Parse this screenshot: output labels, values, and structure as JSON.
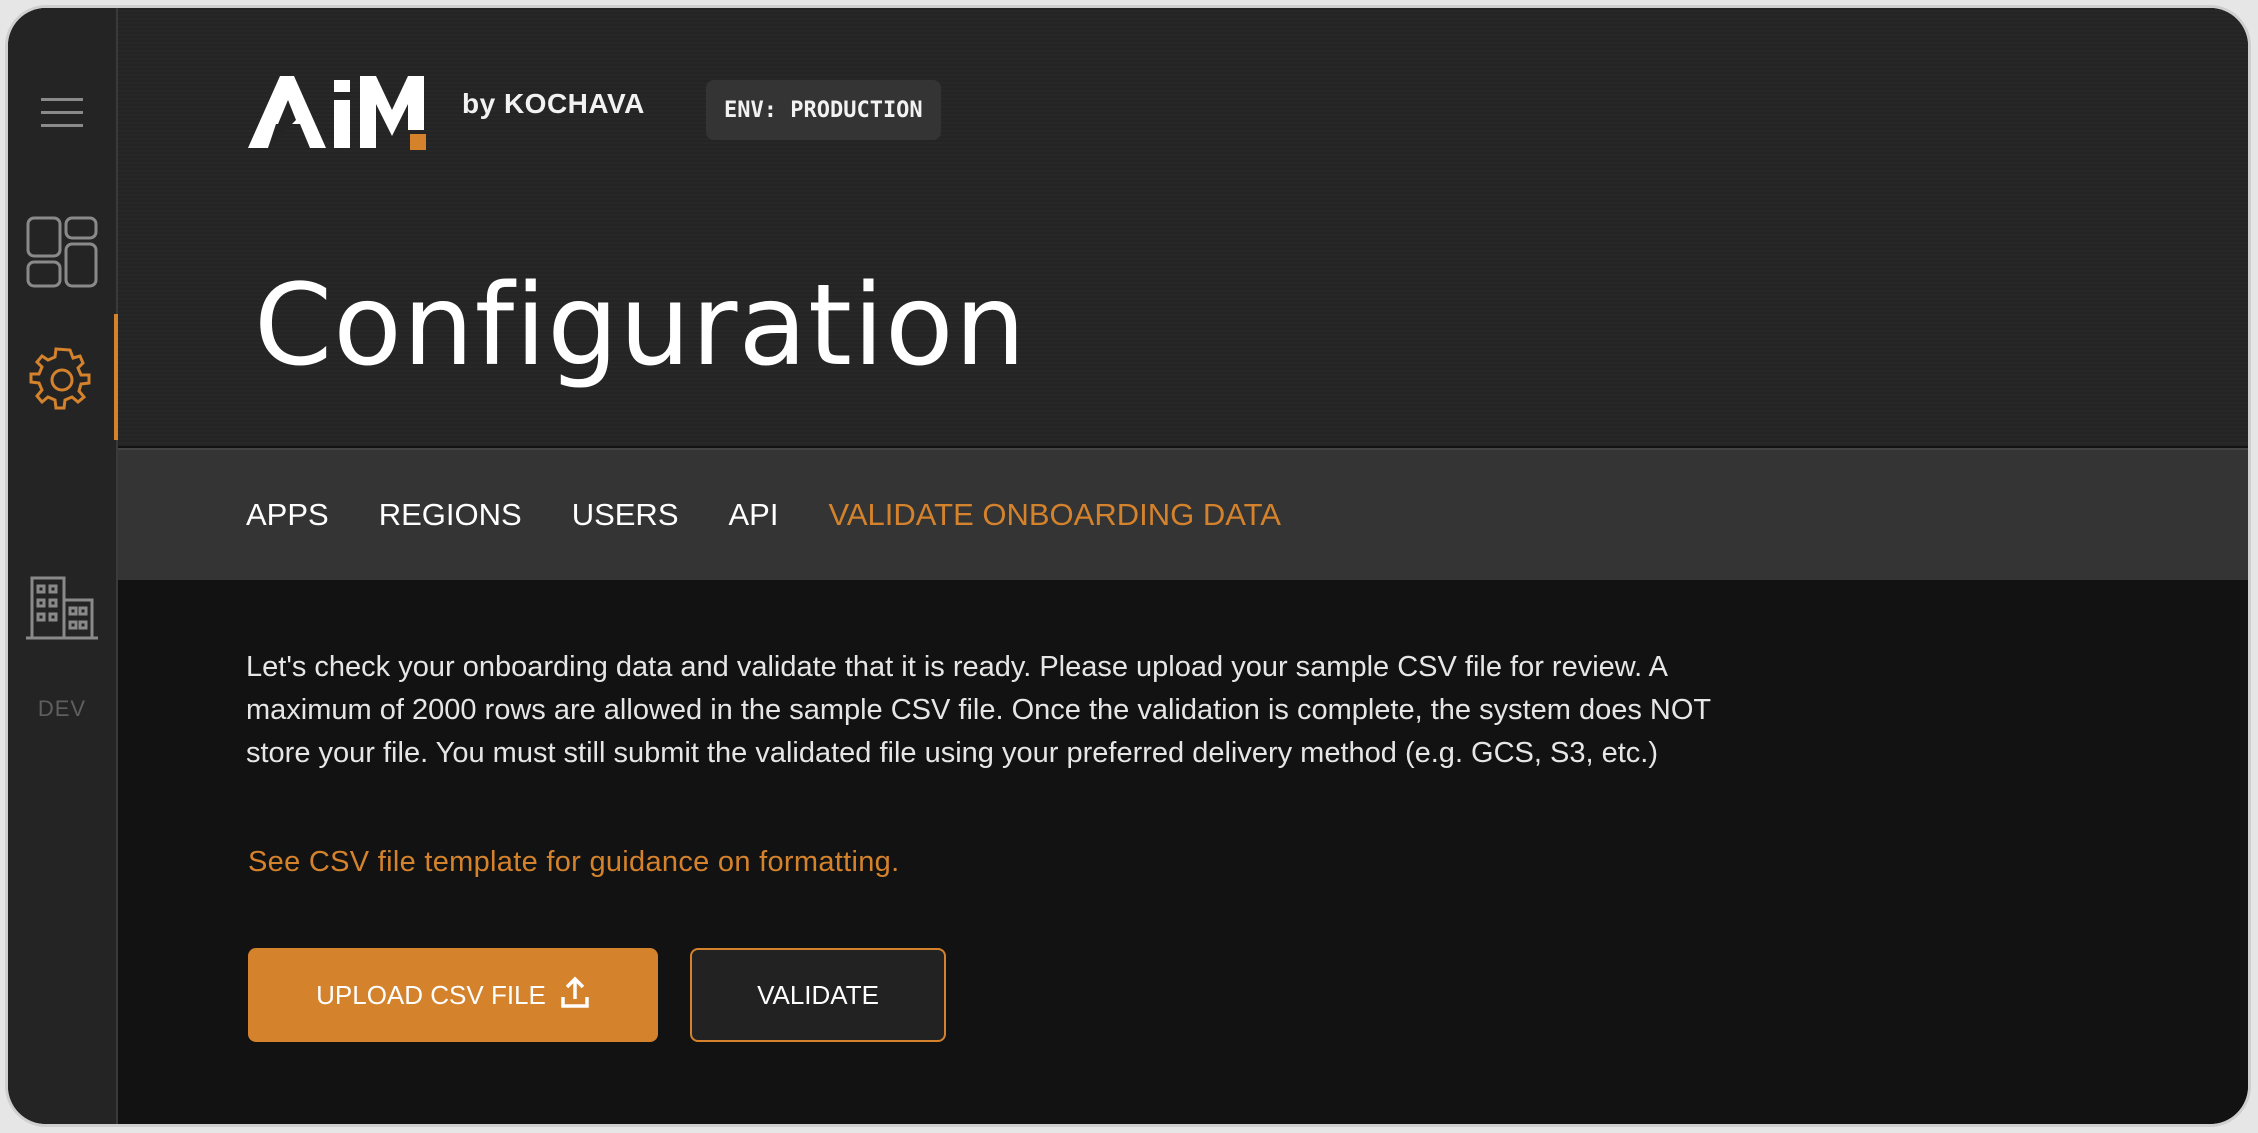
{
  "colors": {
    "accent": "#d4822b",
    "background": "#121212",
    "sidebar": "#242424",
    "tabbar": "#343434"
  },
  "sidebar": {
    "items": [
      {
        "icon": "hamburger-menu-icon"
      },
      {
        "icon": "dashboard-grid-icon"
      },
      {
        "icon": "settings-gear-icon",
        "active": true
      },
      {
        "icon": "building-icon"
      }
    ],
    "env_label": "DEV"
  },
  "header": {
    "logo_text": "AiM",
    "logo_by": "by KOCHAVA",
    "env_badge": "ENV: PRODUCTION",
    "title": "Configuration"
  },
  "tabs": [
    {
      "label": "APPS",
      "active": false
    },
    {
      "label": "REGIONS",
      "active": false
    },
    {
      "label": "USERS",
      "active": false
    },
    {
      "label": "API",
      "active": false
    },
    {
      "label": "VALIDATE ONBOARDING DATA",
      "active": true
    }
  ],
  "main": {
    "description": "Let's check your onboarding data and validate that it is ready. Please upload your sample CSV file for review. A maximum of 2000 rows are allowed in the sample CSV file. Once the validation is complete, the system does NOT store your file. You must still submit the validated file using your preferred delivery method (e.g. GCS, S3, etc.)",
    "template_link": "See CSV file template for guidance on formatting.",
    "upload_button": "UPLOAD CSV FILE",
    "upload_icon": "upload-icon",
    "validate_button": "VALIDATE"
  }
}
